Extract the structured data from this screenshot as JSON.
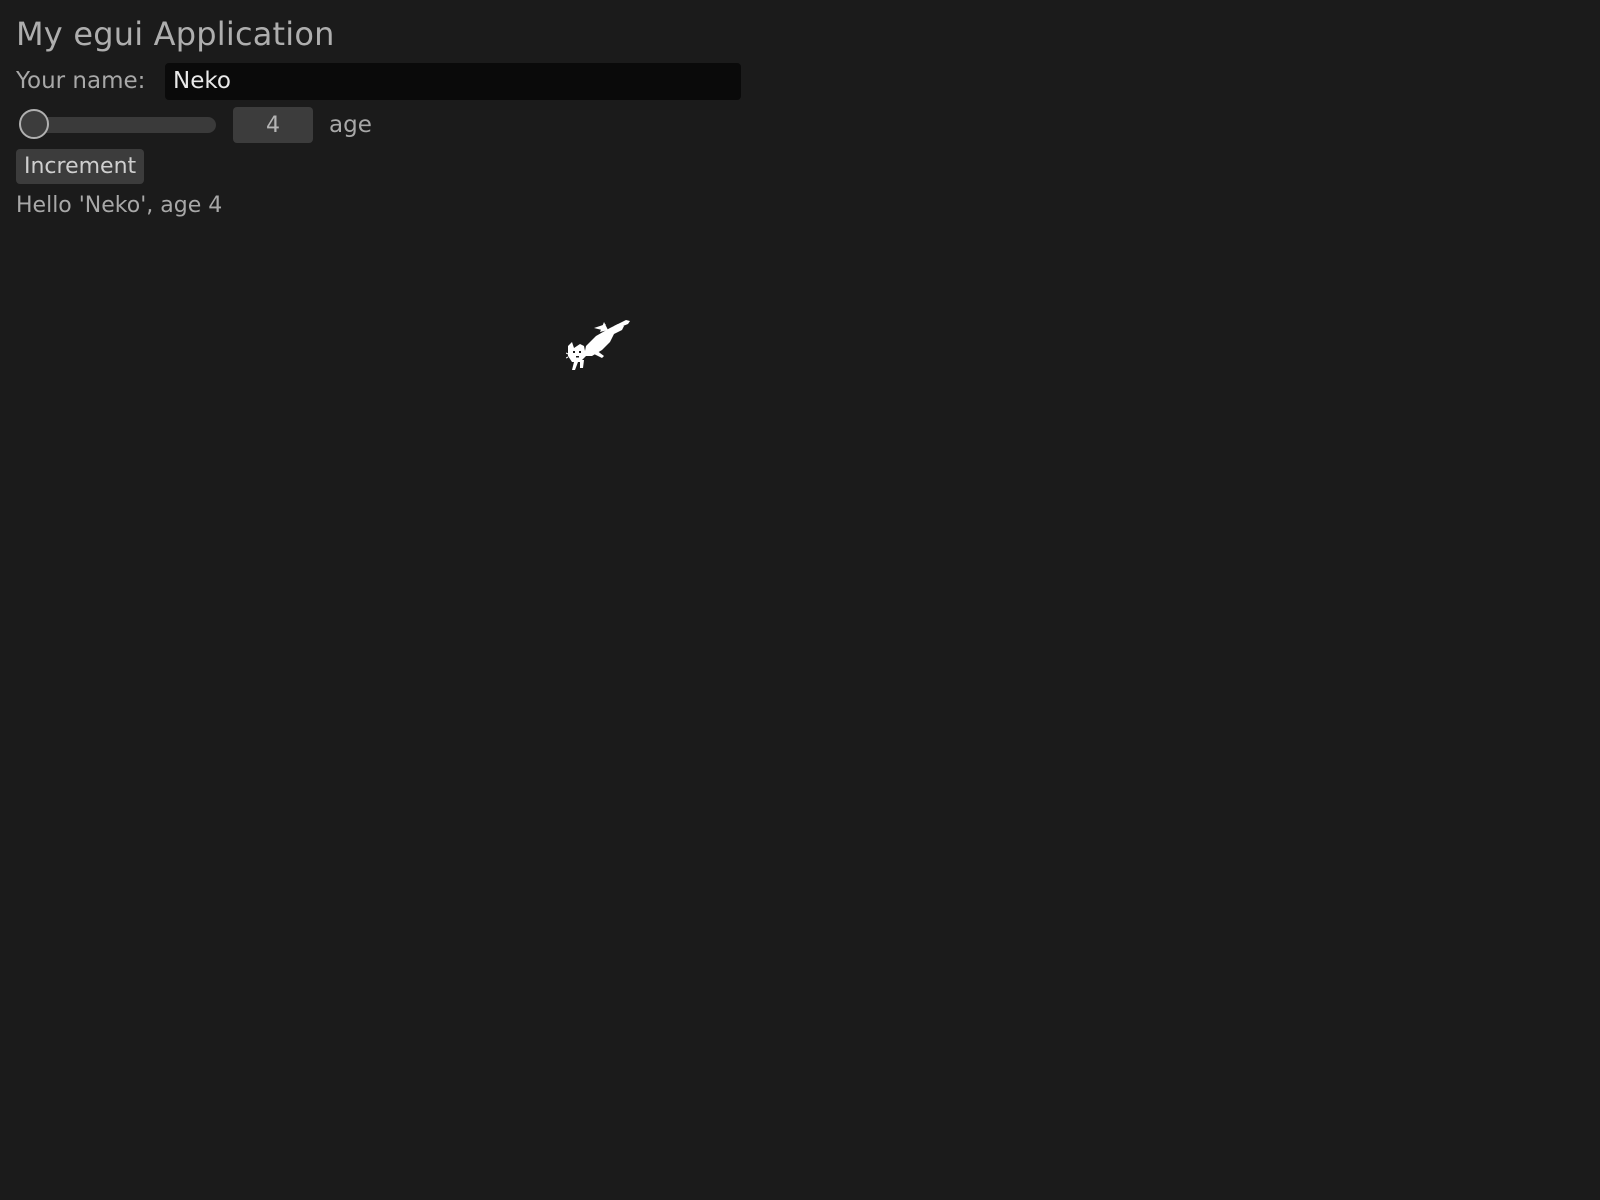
{
  "app": {
    "heading": "My egui Application"
  },
  "name_field": {
    "label": "Your name:",
    "value": "Neko"
  },
  "age_slider": {
    "value": "4",
    "label": "age",
    "fraction": 0.0
  },
  "increment_button": {
    "label": "Increment"
  },
  "greeting": {
    "text": "Hello 'Neko', age 4"
  },
  "image": {
    "icon": "running-cat-icon"
  },
  "colors": {
    "background": "#1b1b1b",
    "text": "#a8a8a8",
    "input_background": "#0a0a0a",
    "widget_background": "#3c3c3c"
  }
}
